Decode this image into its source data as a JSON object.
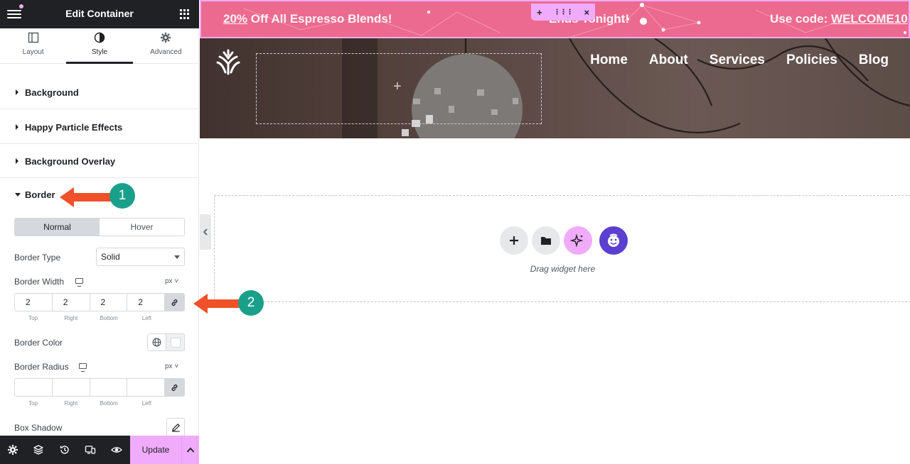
{
  "panel": {
    "title": "Edit Container",
    "tabs": [
      {
        "label": "Layout",
        "icon": "layout-icon"
      },
      {
        "label": "Style",
        "icon": "style-icon"
      },
      {
        "label": "Advanced",
        "icon": "gear-icon"
      }
    ],
    "active_tab": "Style",
    "sections": [
      {
        "label": "Background"
      },
      {
        "label": "Happy Particle Effects"
      },
      {
        "label": "Background Overlay"
      }
    ],
    "border": {
      "label": "Border",
      "state_tabs": [
        "Normal",
        "Hover"
      ],
      "active_state": "Normal",
      "type": {
        "label": "Border Type",
        "value": "Solid"
      },
      "width": {
        "label": "Border Width",
        "unit": "px",
        "values": [
          "2",
          "2",
          "2",
          "2"
        ],
        "labels": [
          "Top",
          "Right",
          "Bottom",
          "Left"
        ]
      },
      "color": {
        "label": "Border Color"
      },
      "radius": {
        "label": "Border Radius",
        "unit": "px",
        "values": [
          "",
          "",
          "",
          ""
        ],
        "labels": [
          "Top",
          "Right",
          "Bottom",
          "Left"
        ]
      },
      "shadow": {
        "label": "Box Shadow"
      }
    },
    "footer": {
      "update_label": "Update"
    }
  },
  "canvas": {
    "promo": {
      "left_highlight": "20%",
      "left_rest": " Off All Espresso Blends!",
      "middle": "Ends Tonight!",
      "right_prefix": "Use code: ",
      "right_code": "WELCOME10",
      "color": "#ec6a8f"
    },
    "nav": [
      "Home",
      "About",
      "Services",
      "Policies",
      "Blog"
    ],
    "dropzone": {
      "text": "Drag widget here"
    }
  },
  "annotations": [
    {
      "number": "1",
      "color": "#1aa08a"
    },
    {
      "number": "2",
      "color": "#1aa08a"
    }
  ],
  "colors": {
    "accent": "#f0abfc",
    "arrow": "#f0502a",
    "badge": "#1aa08a",
    "dark": "#1f2124"
  }
}
